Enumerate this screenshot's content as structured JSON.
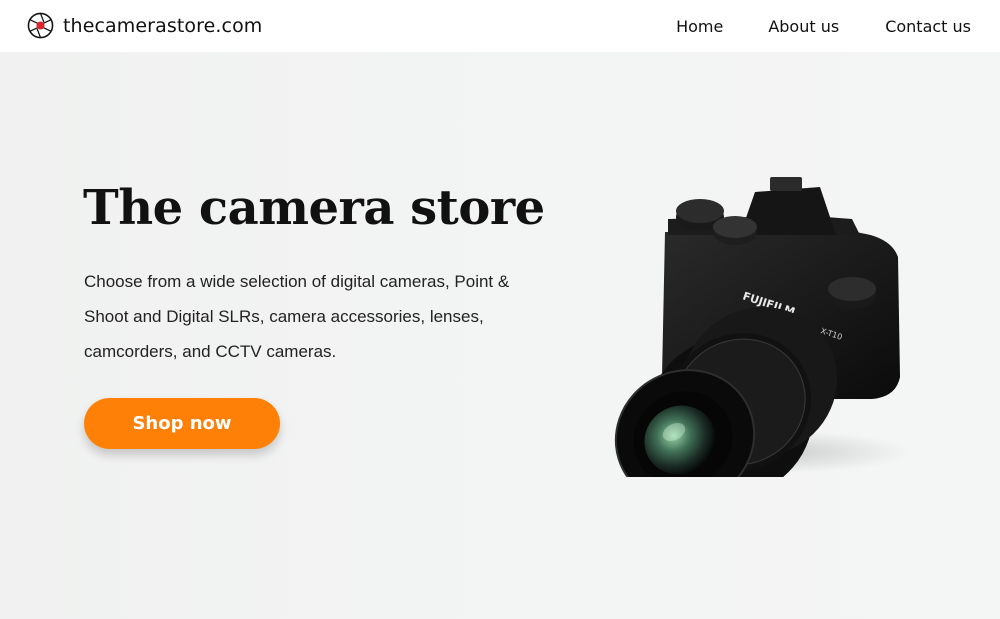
{
  "header": {
    "site_name": "thecamerastore.com",
    "logo_icon": "aperture-icon",
    "nav": {
      "home": "Home",
      "about": "About us",
      "contact": "Contact us"
    }
  },
  "hero": {
    "title": "The camera store",
    "description": "Choose from a wide selection of digital cameras, Point & Shoot and Digital SLRs, camera accessories, lenses, camcorders, and CCTV cameras.",
    "cta_label": "Shop now",
    "camera": {
      "brand": "FUJIFILM",
      "model": "X-T10"
    }
  },
  "colors": {
    "accent": "#ff8007",
    "logo_red": "#d9252b",
    "background": "#f1f2f2"
  }
}
